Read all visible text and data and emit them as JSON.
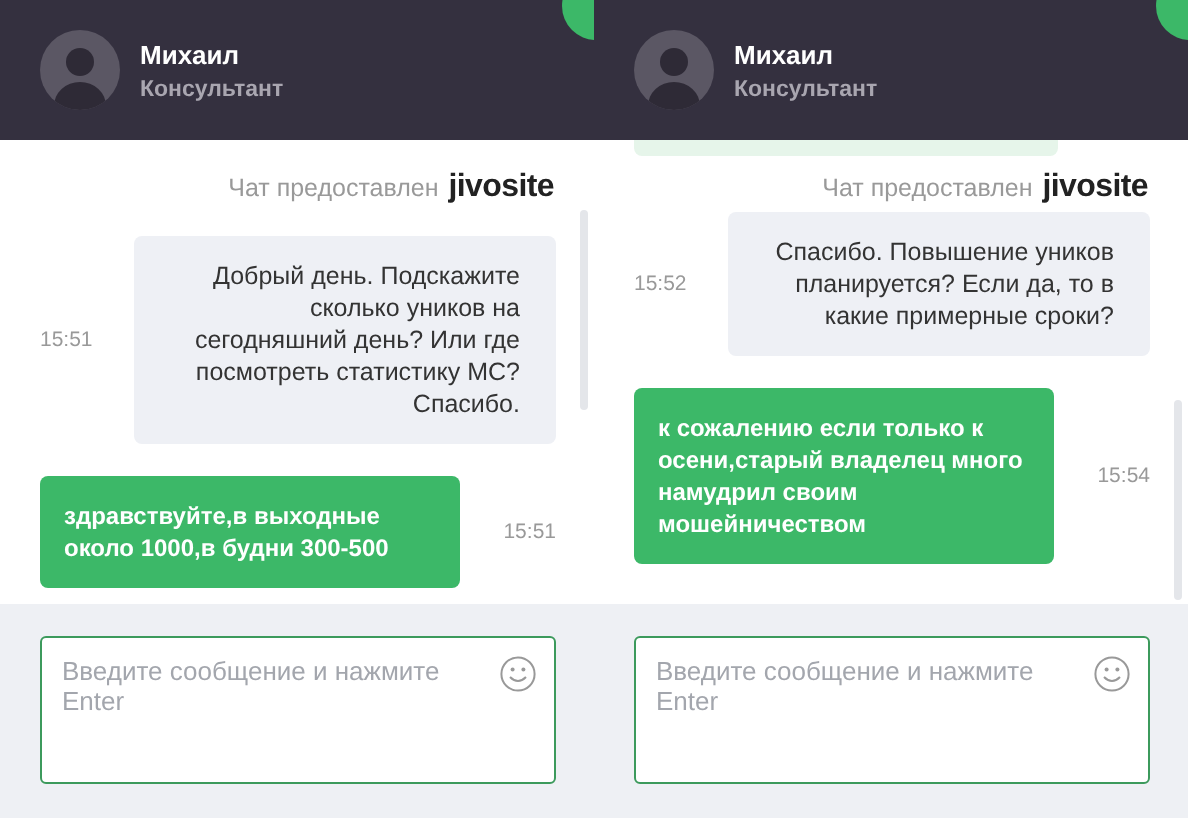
{
  "panels": [
    {
      "agent": {
        "name": "Михаил",
        "role": "Консультант"
      },
      "credit": {
        "text": "Чат предоставлен",
        "brand": "jivosite"
      },
      "messages": [
        {
          "kind": "visitor",
          "text": "Добрый день. Подскажите сколько уников на сегодняшний день? Или где посмотреть статистику МС? Спасибо.",
          "time": "15:51"
        },
        {
          "kind": "agent",
          "text": "здравствуйте,в выходные около 1000,в будни 300-500",
          "time": "15:51"
        }
      ],
      "input": {
        "placeholder": "Введите сообщение и нажмите Enter"
      }
    },
    {
      "agent": {
        "name": "Михаил",
        "role": "Консультант"
      },
      "clipped_bubble_above": true,
      "credit": {
        "text": "Чат предоставлен",
        "brand": "jivosite"
      },
      "messages": [
        {
          "kind": "visitor",
          "text": "Спасибо. Повышение уников планируется? Если да, то в какие примерные сроки?",
          "time": "15:52"
        },
        {
          "kind": "agent",
          "text": "к сожалению если только к осени,старый владелец много намудрил своим мошейничеством",
          "time": "15:54"
        }
      ],
      "input": {
        "placeholder": "Введите сообщение и нажмите Enter"
      }
    }
  ]
}
